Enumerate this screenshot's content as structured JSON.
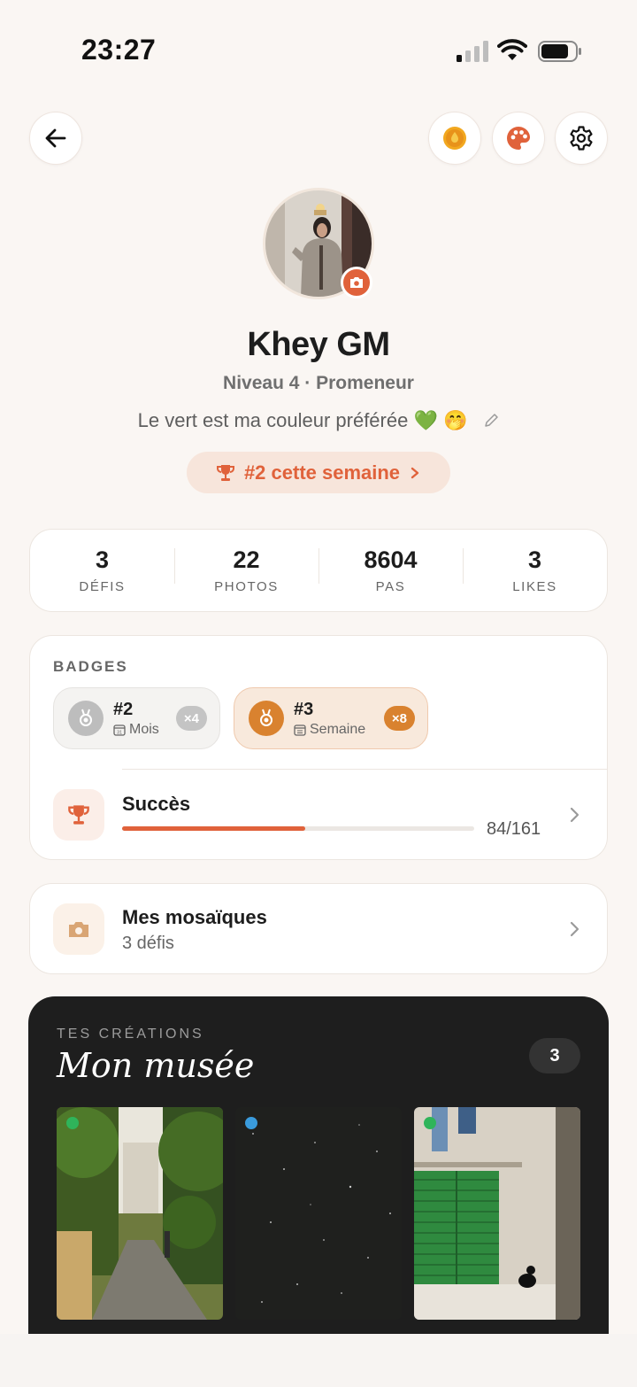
{
  "status": {
    "time": "23:27"
  },
  "header": {
    "back_icon": "arrow-left-icon",
    "coin_icon": "coin-drop-icon",
    "palette_icon": "palette-icon",
    "settings_icon": "gear-icon"
  },
  "profile": {
    "name": "Khey GM",
    "level": "Niveau 4 · Promeneur",
    "bio": "Le vert est ma couleur préférée 💚 🤭",
    "rank_label": "#2 cette semaine"
  },
  "stats": [
    {
      "value": "3",
      "label": "DÉFIS"
    },
    {
      "value": "22",
      "label": "PHOTOS"
    },
    {
      "value": "8604",
      "label": "PAS"
    },
    {
      "value": "3",
      "label": "LIKES"
    }
  ],
  "badges": {
    "title": "BADGES",
    "items": [
      {
        "rank": "#2",
        "period": "Mois",
        "count": "×4"
      },
      {
        "rank": "#3",
        "period": "Semaine",
        "count": "×8"
      }
    ],
    "success": {
      "label": "Succès",
      "count": "84/161",
      "progress": 0.52
    }
  },
  "mosaics": {
    "title": "Mes mosaïques",
    "subtitle": "3 défis"
  },
  "museum": {
    "kicker": "TES CRÉATIONS",
    "title": "Mon musée",
    "count": "3"
  },
  "colors": {
    "accent": "#e0623b",
    "gold": "#d98a3c",
    "green": "#2fb45a",
    "blue": "#3a9bdc"
  }
}
